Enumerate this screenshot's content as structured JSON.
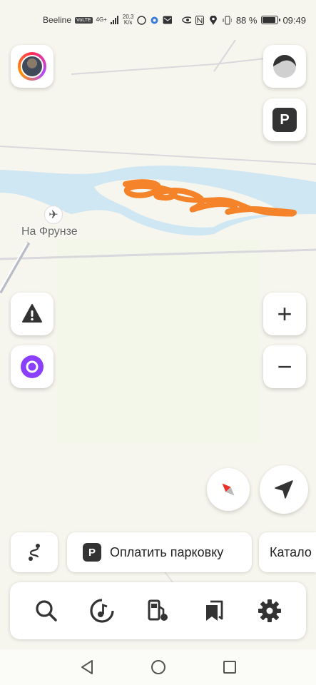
{
  "status_bar": {
    "carrier": "Beeline",
    "volte": "VoLTE",
    "network": "4G+",
    "speed_value": "20,3",
    "speed_unit": "K/s",
    "battery_percent": "88 %",
    "battery_level": 0.88,
    "time": "09:49"
  },
  "map": {
    "place_label": "На Фрунзе",
    "water_color": "#cfe6f3",
    "land_color": "#f7f6ee",
    "route_color": "#f5832a"
  },
  "chips": {
    "parking_pay_label": "Оплатить парковку",
    "parking_icon_letter": "P",
    "catalog_label": "Катало"
  },
  "buttons": {
    "parking_letter": "P",
    "zoom_in": "+",
    "zoom_out": "−"
  },
  "toolbar": {
    "items": [
      "search-icon",
      "music-icon",
      "fuel-icon",
      "bookmarks-icon",
      "settings-icon"
    ]
  },
  "icons": {
    "alert": "warning-icon",
    "assistant": "alice-icon",
    "compass": "compass-icon",
    "locate": "navigate-arrow-icon",
    "route": "route-icon"
  }
}
